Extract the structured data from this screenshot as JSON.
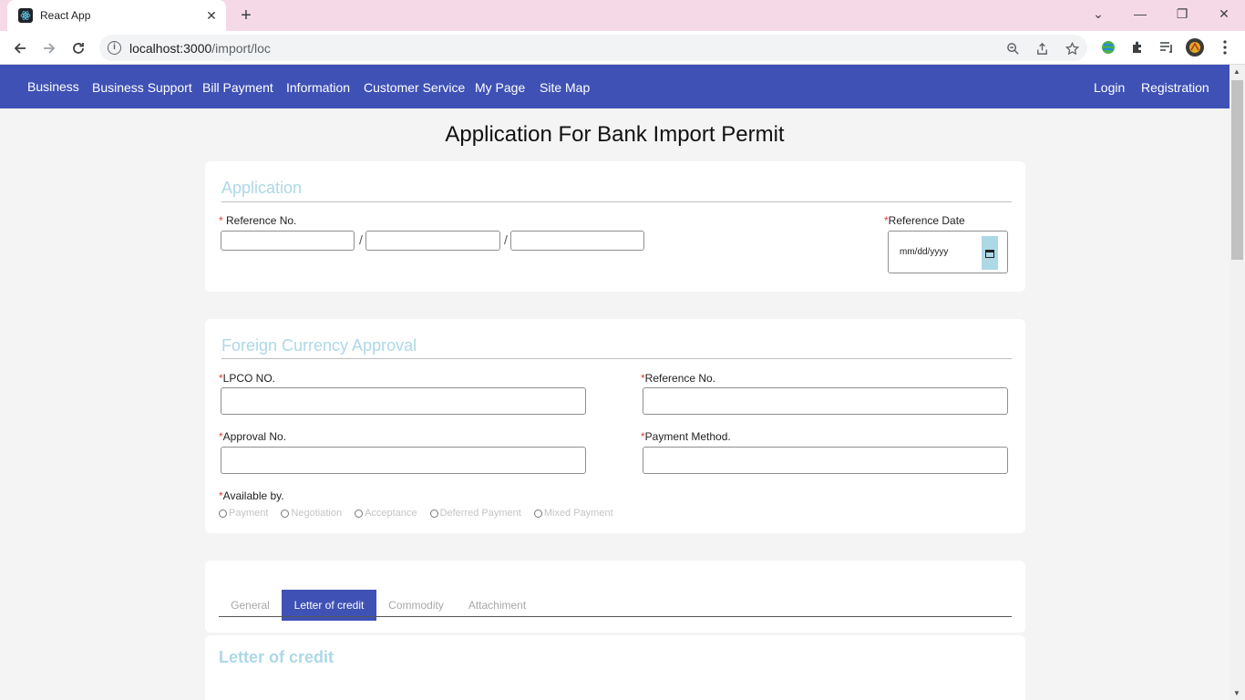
{
  "browser": {
    "tab_title": "React App",
    "tab_close": "✕",
    "new_tab": "+",
    "url_host": "localhost:3000",
    "url_path": "/import/loc",
    "win_minimize": "—",
    "win_restore": "❐",
    "win_close": "✕",
    "tab_list": "⌄"
  },
  "navbar": {
    "items": [
      "Business",
      "Business Support",
      "Bill Payment",
      "Information",
      "Customer Service",
      "My Page",
      "Site Map"
    ],
    "login": "Login",
    "registration": "Registration"
  },
  "page": {
    "title": "Application For Bank Import Permit"
  },
  "application": {
    "title": "Application",
    "reference_no_label": " Reference No.",
    "reference_date_label": "Reference Date",
    "date_placeholder": "mm/dd/yyyy",
    "separator": "/"
  },
  "fca": {
    "title": "Foreign Currency Approval",
    "lpco_label": "LPCO NO.",
    "reference_label": "Reference No.",
    "approval_label": "Approval No.",
    "payment_method_label": "Payment Method.",
    "available_label": "Available by.",
    "options": [
      "Payment",
      "Negotiation",
      "Acceptance",
      "Deferred Payment",
      "Mixed Payment"
    ]
  },
  "tabs": {
    "items": [
      "General",
      "Letter of credit",
      "Commodity",
      "Attachiment"
    ],
    "active": "Letter of credit"
  },
  "section": {
    "title": "Letter of credit"
  },
  "required_mark": "*",
  "colors": {
    "navbar": "#3f51b5",
    "section_title": "#add8e6",
    "tab_bar": "#f6d9e6",
    "required": "#e53935"
  }
}
